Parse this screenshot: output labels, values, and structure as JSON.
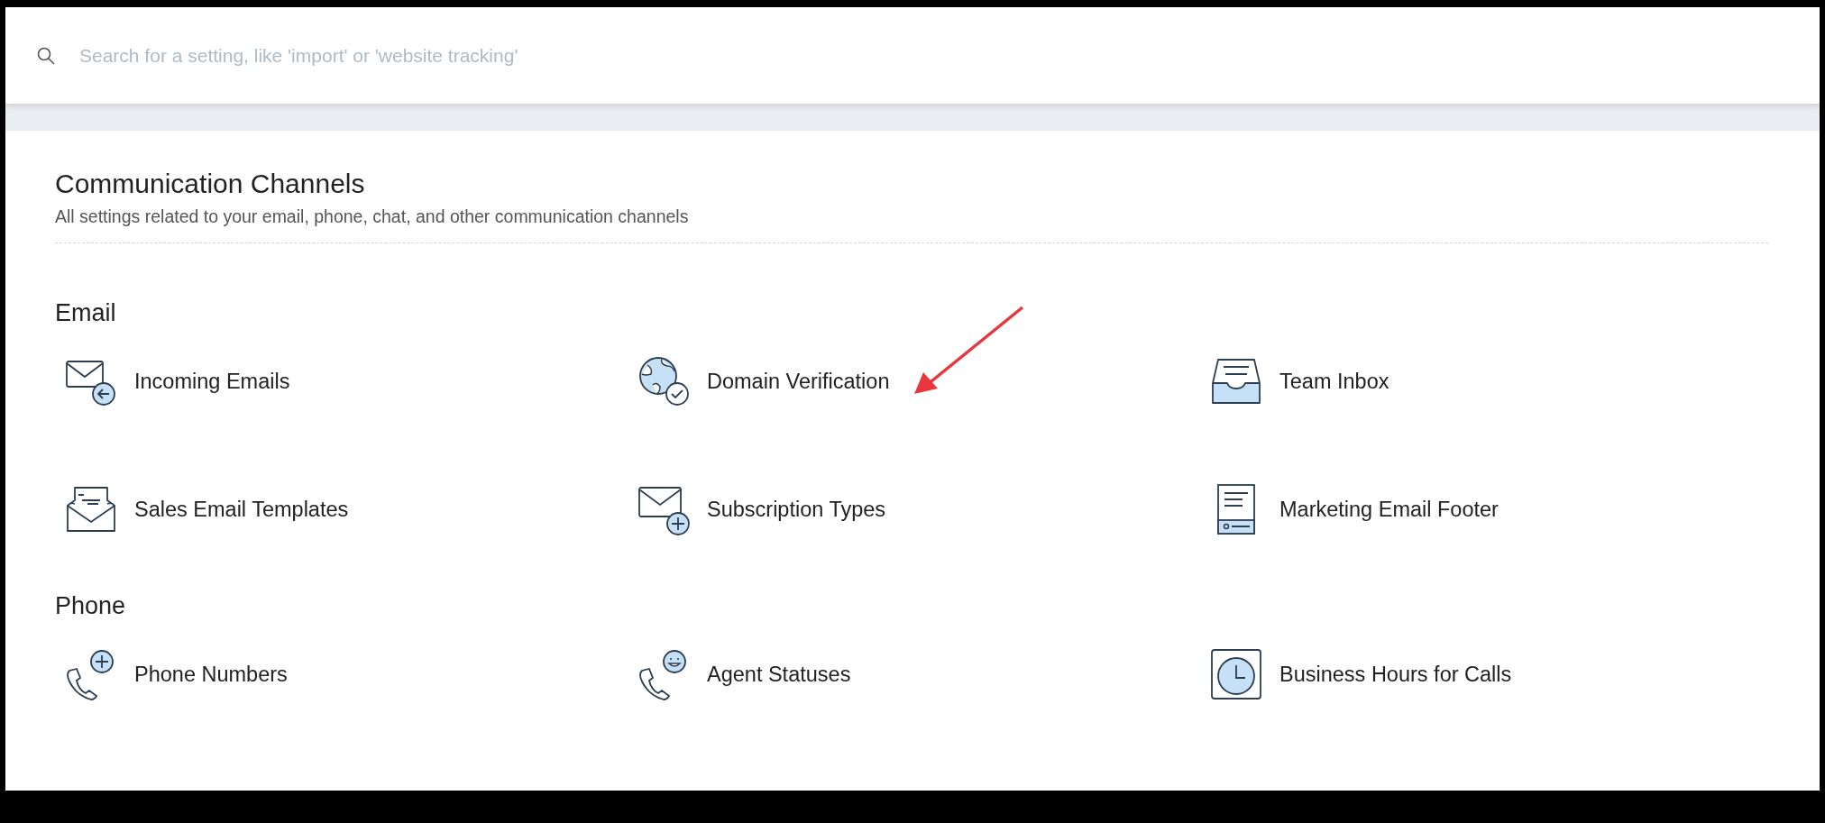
{
  "search": {
    "placeholder": "Search for a setting, like 'import' or 'website tracking'"
  },
  "page": {
    "title": "Communication Channels",
    "subtitle": "All settings related to your email, phone, chat, and other communication channels"
  },
  "sections": [
    {
      "title": "Email",
      "items": [
        {
          "label": "Incoming Emails",
          "kind": "mail-arrow"
        },
        {
          "label": "Domain Verification",
          "kind": "globe-check"
        },
        {
          "label": "Team Inbox",
          "kind": "inbox"
        },
        {
          "label": "Sales Email Templates",
          "kind": "open-envelope"
        },
        {
          "label": "Subscription Types",
          "kind": "mail-plus"
        },
        {
          "label": "Marketing Email Footer",
          "kind": "document"
        }
      ]
    },
    {
      "title": "Phone",
      "items": [
        {
          "label": "Phone Numbers",
          "kind": "phone-plus"
        },
        {
          "label": "Agent Statuses",
          "kind": "phone-smiley"
        },
        {
          "label": "Business Hours for Calls",
          "kind": "clock"
        }
      ]
    }
  ],
  "annotation": {
    "kind": "arrow"
  }
}
